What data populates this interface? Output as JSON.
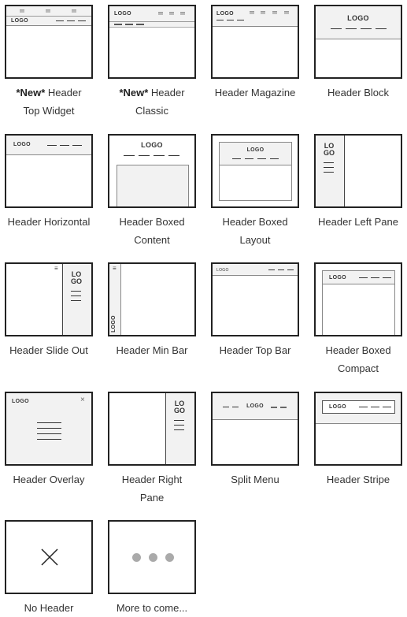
{
  "logo_text": "LOGO",
  "logo_stacked": [
    "LO",
    "GO"
  ],
  "close_glyph": "×",
  "menu_glyph": "≡",
  "items": [
    {
      "id": "header-top-widget",
      "badge": "*New*",
      "label": "Header",
      "label2": "Top Widget"
    },
    {
      "id": "header-classic",
      "badge": "*New*",
      "label": "Header",
      "label2": "Classic"
    },
    {
      "id": "header-magazine",
      "label": "Header Magazine"
    },
    {
      "id": "header-block",
      "label": "Header Block"
    },
    {
      "id": "header-horizontal",
      "label": "Header Horizontal"
    },
    {
      "id": "header-boxed-content",
      "label": "Header Boxed",
      "label2": "Content"
    },
    {
      "id": "header-boxed-layout",
      "label": "Header Boxed",
      "label2": "Layout"
    },
    {
      "id": "header-left-pane",
      "label": "Header Left Pane"
    },
    {
      "id": "header-slide-out",
      "label": "Header Slide Out"
    },
    {
      "id": "header-min-bar",
      "label": "Header Min Bar"
    },
    {
      "id": "header-top-bar",
      "label": "Header Top Bar"
    },
    {
      "id": "header-boxed-compact",
      "label": "Header Boxed",
      "label2": "Compact"
    },
    {
      "id": "header-overlay",
      "label": "Header Overlay"
    },
    {
      "id": "header-right-pane",
      "label": "Header Right",
      "label2": "Pane"
    },
    {
      "id": "split-menu",
      "label": "Split Menu"
    },
    {
      "id": "header-stripe",
      "label": "Header Stripe"
    },
    {
      "id": "no-header",
      "label": "No Header"
    },
    {
      "id": "more-to-come",
      "label": "More to come..."
    }
  ],
  "colors": {
    "border": "#222222",
    "header_fill": "#f2f2f2",
    "dot": "#aaaaaa",
    "label": "#333333"
  }
}
